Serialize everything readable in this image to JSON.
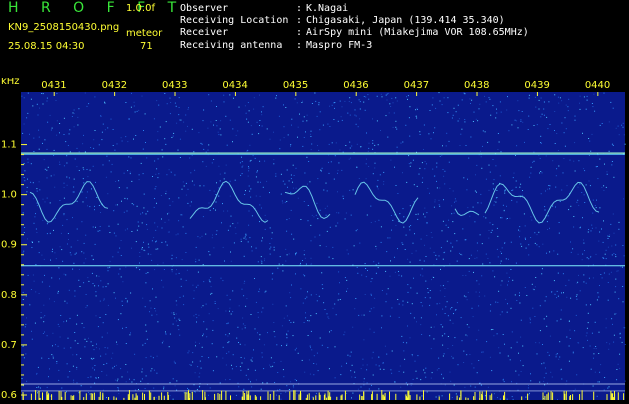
{
  "header": {
    "brand": "H R O F F T",
    "version": "1.0.0f",
    "filename": "KN9_2508150430.png",
    "meteor_label": "meteor",
    "meteor_count": "71",
    "datetime": "25.08.15 04:30"
  },
  "info": [
    {
      "label": "Observer",
      "value": "K.Nagai"
    },
    {
      "label": "Receiving Location",
      "value": "Chigasaki, Japan (139.414 35.340)"
    },
    {
      "label": "Receiver",
      "value": "AirSpy mini (Miakejima VOR 108.65MHz)"
    },
    {
      "label": "Receiving antenna",
      "value": "Maspro FM-3"
    }
  ],
  "spectrogram": {
    "unit_label": "kHz",
    "y_ticks": [
      "1.1",
      "1.0",
      "0.9",
      "0.8",
      "0.7",
      "0.6"
    ],
    "y_tick_values": [
      1.1,
      1.0,
      0.9,
      0.8,
      0.7,
      0.6
    ],
    "time_labels": [
      "0431",
      "0432",
      "0433",
      "0434",
      "0435",
      "0436",
      "0437",
      "0438",
      "0439",
      "0440"
    ],
    "y_range": [
      0.59,
      1.205
    ],
    "colors": {
      "background": "#0a1a8c",
      "noise": "#3aa0ff",
      "trace": "#7ff0ff",
      "axis": "#ffff33"
    }
  }
}
